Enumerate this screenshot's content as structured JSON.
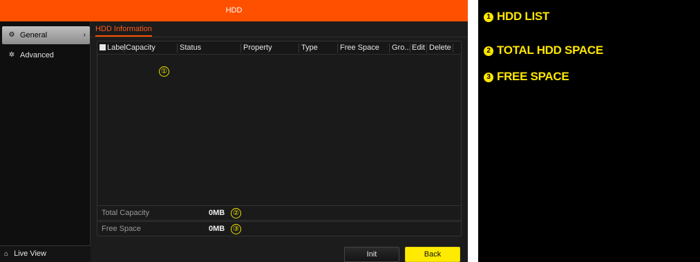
{
  "window": {
    "title": "HDD"
  },
  "sidebar": {
    "items": [
      {
        "label": "General",
        "icon": "gear-icon",
        "active": true
      },
      {
        "label": "Advanced",
        "icon": "settings-icon",
        "active": false
      }
    ],
    "live_view": {
      "label": "Live View",
      "icon": "home-icon"
    }
  },
  "main": {
    "tab": "HDD Information",
    "table": {
      "columns": [
        "Label",
        "Capacity",
        "Status",
        "Property",
        "Type",
        "Free Space",
        "Gro...",
        "Edit",
        "Delete"
      ],
      "rows": []
    },
    "total_capacity": {
      "label": "Total Capacity",
      "value": "0MB"
    },
    "free_space": {
      "label": "Free Space",
      "value": "0MB"
    },
    "buttons": {
      "init": "Init",
      "back": "Back"
    }
  },
  "markers": [
    "①",
    "②",
    "③"
  ],
  "legend": [
    {
      "num": "1",
      "text": "HDD LIST"
    },
    {
      "num": "2",
      "text": "TOTAL HDD SPACE"
    },
    {
      "num": "3",
      "text": "FREE SPACE"
    }
  ],
  "colors": {
    "title_bar": "#ff5000",
    "accent": "#ff5a1a",
    "back_button": "#ffeb00",
    "annotation": "#ffe600"
  }
}
